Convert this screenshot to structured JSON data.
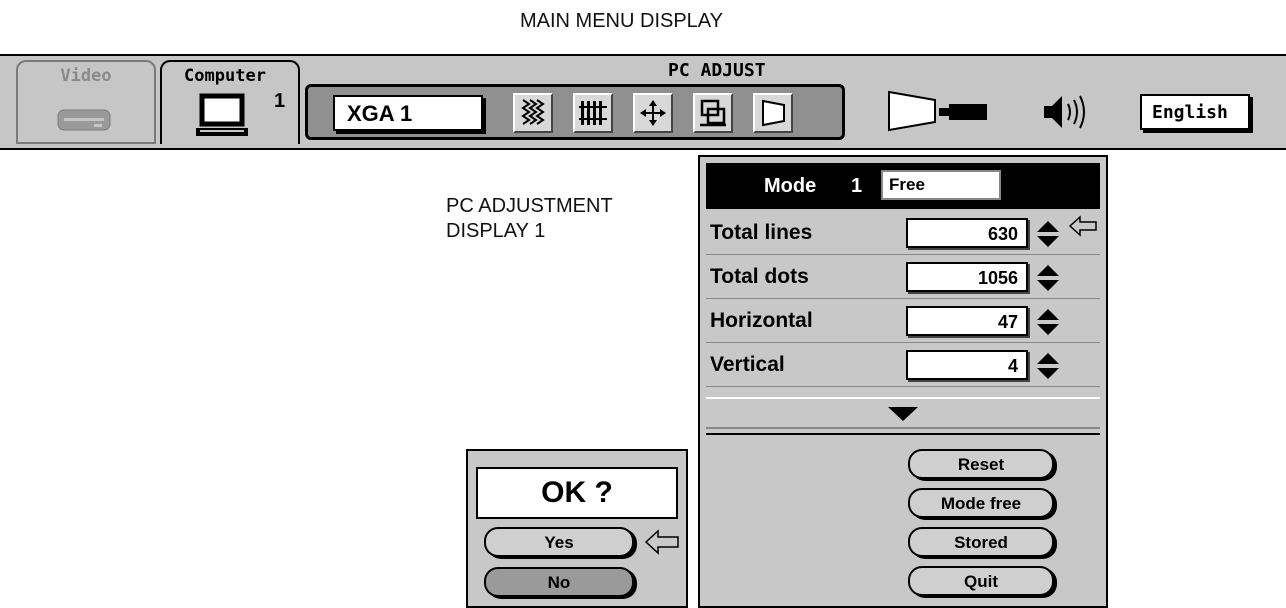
{
  "captions": {
    "main_menu": "MAIN MENU DISPLAY",
    "pc_adjust_line1": "PC ADJUSTMENT",
    "pc_adjust_line2": "DISPLAY 1"
  },
  "topbar": {
    "tabs": [
      {
        "label": "Video",
        "icon": "vcr-icon",
        "active": false
      },
      {
        "label": "Computer",
        "icon": "monitor-icon",
        "number": "1",
        "active": true
      }
    ],
    "panel_title": "PC ADJUST",
    "source": "XGA 1",
    "tools": [
      "sync-icon",
      "fine-sync-icon",
      "position-icon",
      "multi-window-icon",
      "keystone-icon"
    ],
    "right_icons": [
      "projector-icon",
      "speaker-icon"
    ],
    "language": "English"
  },
  "pc_adjust": {
    "mode_label": "Mode",
    "mode_number": "1",
    "mode_value": "Free",
    "rows": [
      {
        "label": "Total lines",
        "value": "630"
      },
      {
        "label": "Total dots",
        "value": "1056"
      },
      {
        "label": "Horizontal",
        "value": "47"
      },
      {
        "label": "Vertical",
        "value": "4"
      }
    ],
    "buttons": [
      "Reset",
      "Mode free",
      "Stored",
      "Quit"
    ]
  },
  "confirm": {
    "title": "OK ?",
    "yes": "Yes",
    "no": "No"
  },
  "colors": {
    "bar_bg": "#c6c6c6",
    "panel_bg": "#c8c8c8",
    "highlight": "#000000",
    "no_button": "#9a9a9a"
  }
}
